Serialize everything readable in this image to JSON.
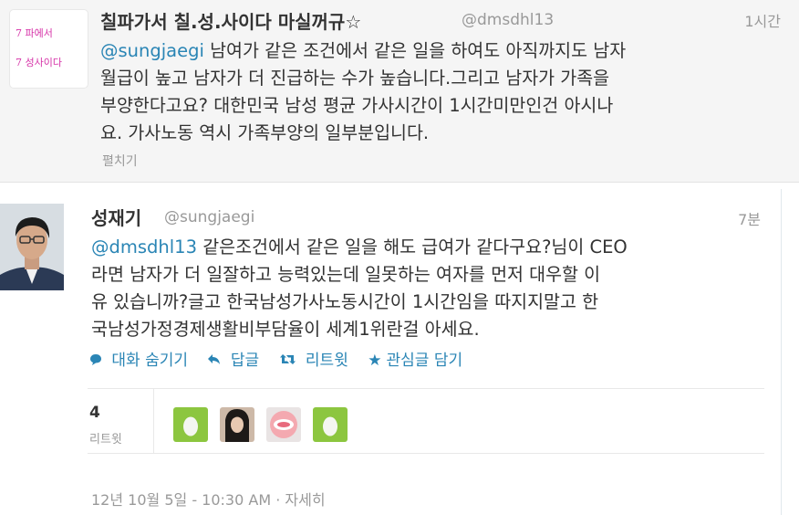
{
  "tweet1": {
    "avatar_lines": [
      "7 파에서",
      "7 성사이다"
    ],
    "name": "칠파가서 칠.성.사이다 마실꺼규☆",
    "handle": "@dmsdhl13",
    "time": "1시간",
    "mention": "@sungjaegi",
    "lines": [
      " 남여가 같은 조건에서 같은 일을 하여도 아직까지도 남자",
      "월급이 높고 남자가 더 진급하는 수가 높습니다.그리고 남자가 가족을",
      "부양한다고요? 대한민국 남성 평균 가사시간이 1시간미만인건 아시나",
      "요. 가사노동 역시 가족부양의 일부분입니다."
    ],
    "expand": "펼치기"
  },
  "tweet2": {
    "name": "성재기",
    "handle": "@sungjaegi",
    "time": "7분",
    "mention": "@dmsdhl13",
    "lines": [
      " 같은조건에서 같은 일을 해도 급여가 같다구요?님이 CEO",
      "라면 남자가 더 일잘하고 능력있는데 일못하는 여자를 먼저 대우할 이",
      "유 있습니까?글고 한국남성가사노동시간이 1시간임을 따지지말고 한",
      "국남성가정경제생활비부담율이 세계1위란걸 아세요."
    ],
    "actions": {
      "hide_conversation": "대화 숨기기",
      "reply": "답글",
      "retweet": "리트윗",
      "favorite": "관심글 담기"
    },
    "retweet_count": "4",
    "retweet_label": "리트윗",
    "date": "12년 10월 5일 - 10:30 AM",
    "separator": " · ",
    "details": "자세히",
    "colors": {
      "link": "#2a85b5",
      "muted": "#999999",
      "egg": "#8cc63f"
    }
  }
}
